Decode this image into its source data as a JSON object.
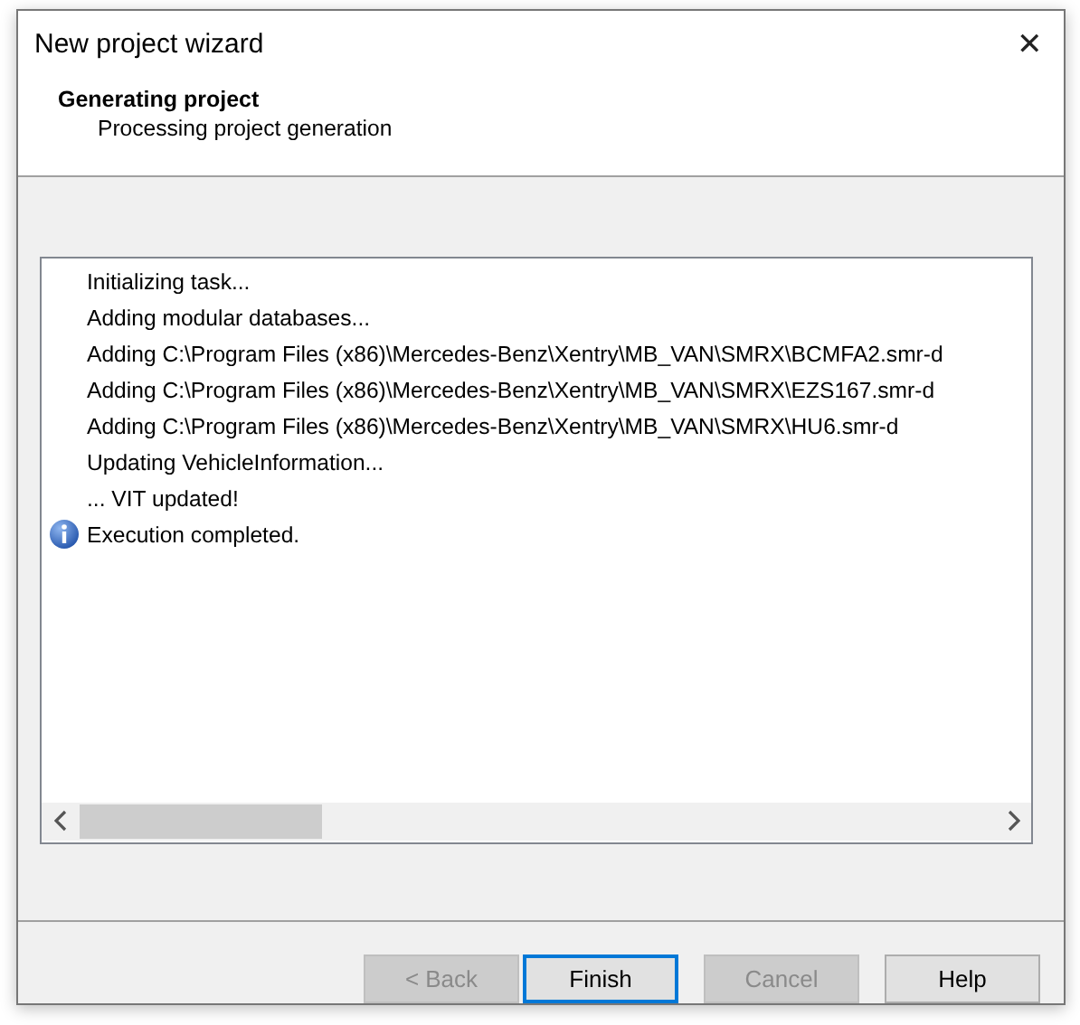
{
  "window": {
    "title": "New project wizard",
    "close": "✕"
  },
  "header": {
    "title": "Generating project",
    "subtitle": "Processing project generation"
  },
  "log": [
    {
      "text": "Initializing task...",
      "kind": "plain"
    },
    {
      "text": "Adding modular databases...",
      "kind": "plain"
    },
    {
      "text": "Adding C:\\Program Files (x86)\\Mercedes-Benz\\Xentry\\MB_VAN\\SMRX\\BCMFA2.smr-d",
      "kind": "plain"
    },
    {
      "text": "Adding C:\\Program Files (x86)\\Mercedes-Benz\\Xentry\\MB_VAN\\SMRX\\EZS167.smr-d",
      "kind": "plain"
    },
    {
      "text": "Adding C:\\Program Files (x86)\\Mercedes-Benz\\Xentry\\MB_VAN\\SMRX\\HU6.smr-d",
      "kind": "plain"
    },
    {
      "text": "Updating VehicleInformation...",
      "kind": "plain"
    },
    {
      "text": "... VIT updated!",
      "kind": "plain"
    },
    {
      "text": "Execution completed.",
      "kind": "info"
    }
  ],
  "buttons": [
    {
      "label": "< Back",
      "disabled": true,
      "focused": false
    },
    {
      "label": "Finish",
      "disabled": false,
      "focused": true
    },
    {
      "label": "Cancel",
      "disabled": true,
      "focused": false
    },
    {
      "label": "Help",
      "disabled": false,
      "focused": false
    }
  ]
}
